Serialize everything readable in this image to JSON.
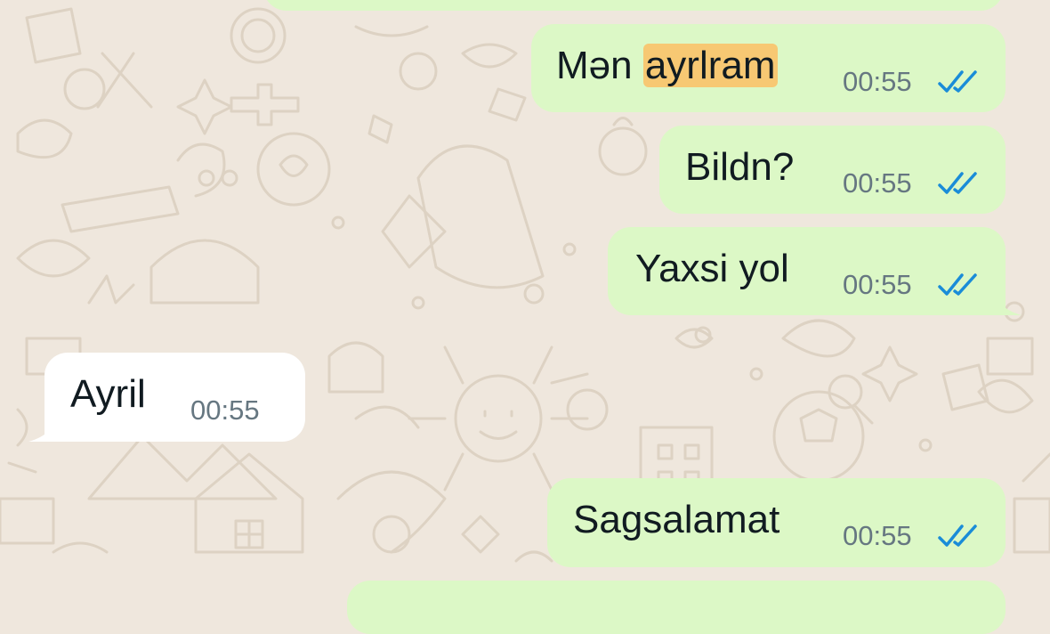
{
  "chat": {
    "messages": [
      {
        "id": "m1",
        "direction": "outgoing",
        "text": "Mən ",
        "highlight": "ayrlram",
        "time": "00:55",
        "status": "read"
      },
      {
        "id": "m2",
        "direction": "outgoing",
        "text": "Bildn?",
        "time": "00:55",
        "status": "read"
      },
      {
        "id": "m3",
        "direction": "outgoing",
        "text": "Yaxsi yol",
        "time": "00:55",
        "status": "read"
      },
      {
        "id": "m4",
        "direction": "incoming",
        "text": "Ayril",
        "time": "00:55"
      },
      {
        "id": "m5",
        "direction": "outgoing",
        "text": "Sagsalamat",
        "time": "00:55",
        "status": "read"
      }
    ]
  },
  "colors": {
    "outgoing_bubble": "#dcf8c6",
    "incoming_bubble": "#ffffff",
    "wallpaper": "#efe7dd",
    "read_ticks": "#1a8cd8",
    "search_highlight": "#f7c873"
  },
  "icons": {
    "read_status": "double-check-icon"
  }
}
